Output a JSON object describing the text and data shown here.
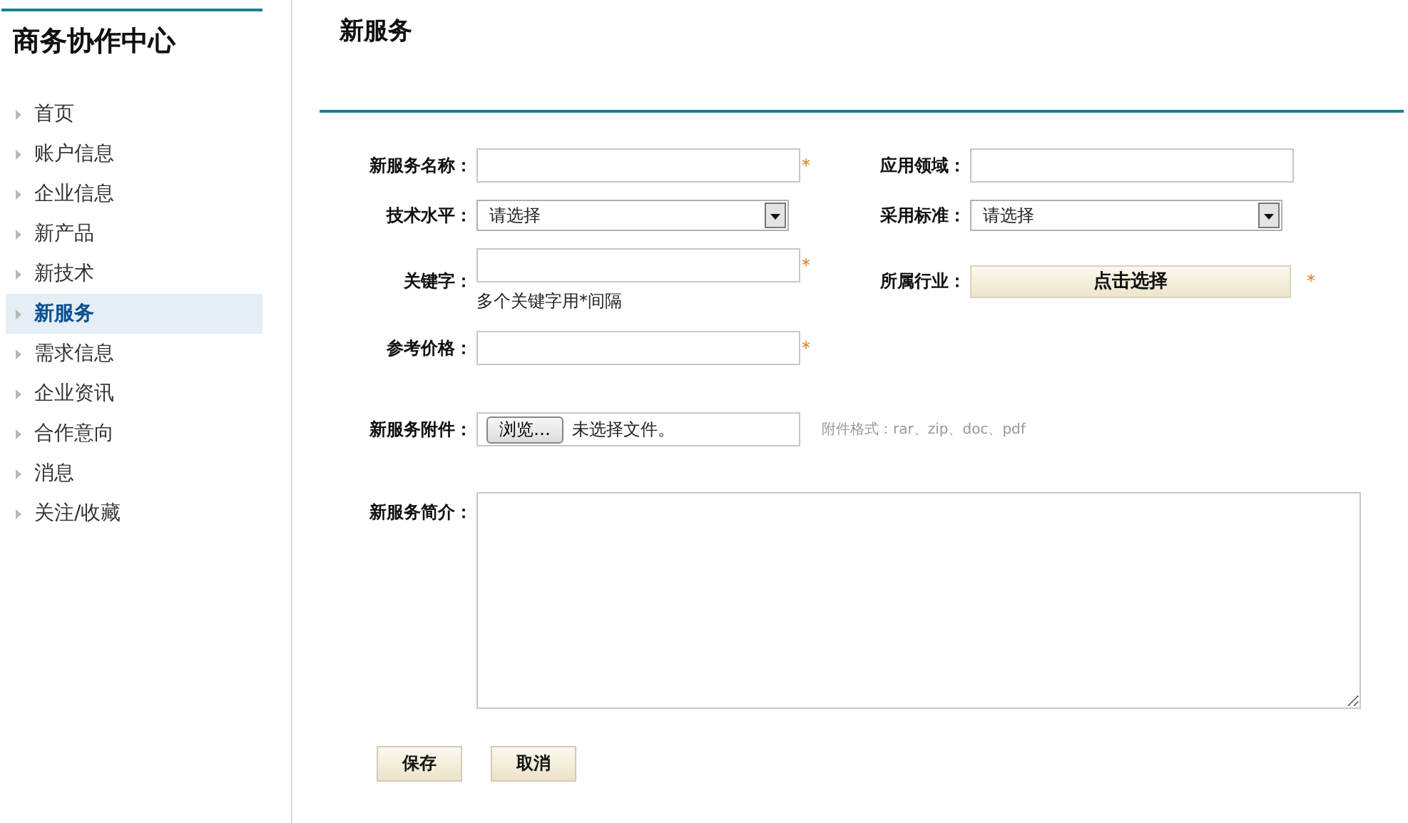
{
  "sidebar": {
    "title": "商务协作中心",
    "items": [
      {
        "label": "首页",
        "selected": false
      },
      {
        "label": "账户信息",
        "selected": false
      },
      {
        "label": "企业信息",
        "selected": false
      },
      {
        "label": "新产品",
        "selected": false
      },
      {
        "label": "新技术",
        "selected": false
      },
      {
        "label": "新服务",
        "selected": true
      },
      {
        "label": "需求信息",
        "selected": false
      },
      {
        "label": "企业资讯",
        "selected": false
      },
      {
        "label": "合作意向",
        "selected": false
      },
      {
        "label": "消息",
        "selected": false
      },
      {
        "label": "关注/收藏",
        "selected": false
      }
    ]
  },
  "page": {
    "title": "新服务"
  },
  "form": {
    "rows": [
      {
        "left": {
          "kind": "text",
          "label": "新服务名称：",
          "required_mark": "*"
        },
        "right": {
          "kind": "text",
          "label": "应用领域："
        }
      },
      {
        "left": {
          "kind": "select",
          "label": "技术水平：",
          "value": "请选择"
        },
        "right": {
          "kind": "select",
          "label": "采用标准：",
          "value": "请选择"
        }
      },
      {
        "left": {
          "kind": "text",
          "label": "关键字：",
          "required_mark": "*",
          "hint": "多个关键字用*间隔"
        },
        "right": {
          "kind": "picker",
          "label": "所属行业：",
          "value": "点击选择",
          "required_mark": "*"
        }
      },
      {
        "left": {
          "kind": "text",
          "label": "参考价格：",
          "required_mark": "*"
        }
      }
    ],
    "attachment": {
      "label": "新服务附件：",
      "button": "浏览…",
      "status": "未选择文件。",
      "note": "附件格式：rar、zip、doc、pdf"
    },
    "description": {
      "label": "新服务简介："
    },
    "buttons": [
      "保存",
      "取消"
    ]
  }
}
